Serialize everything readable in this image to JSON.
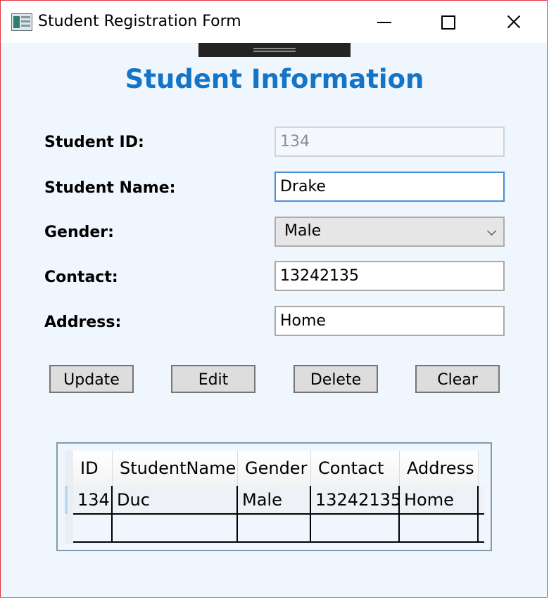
{
  "window": {
    "title": "Student Registration Form"
  },
  "form": {
    "heading": "Student Information",
    "fields": {
      "student_id": {
        "label": "Student ID:",
        "value": "134"
      },
      "student_name": {
        "label": "Student Name:",
        "value": "Drake"
      },
      "gender": {
        "label": "Gender:",
        "value": "Male"
      },
      "contact": {
        "label": "Contact:",
        "value": "13242135"
      },
      "address": {
        "label": "Address:",
        "value": "Home"
      }
    }
  },
  "buttons": {
    "update": "Update",
    "edit": "Edit",
    "delete": "Delete",
    "clear": "Clear"
  },
  "grid": {
    "columns": [
      "ID",
      "StudentName",
      "Gender",
      "Contact",
      "Address"
    ],
    "rows": [
      [
        "134",
        "Duc",
        "Male",
        "13242135",
        "Home"
      ]
    ]
  },
  "colors": {
    "heading": "#1474c7",
    "window_border": "#e0343f",
    "background": "#f0f6fd"
  }
}
